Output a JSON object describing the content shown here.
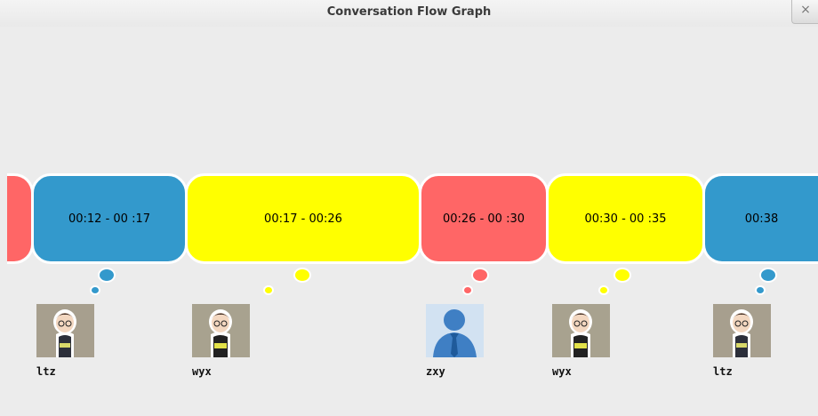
{
  "window": {
    "title": "Conversation Flow Graph",
    "close_symbol": "×"
  },
  "colors": {
    "blue": "#3399cc",
    "yellow": "#ffff00",
    "red": "#ff6666"
  },
  "segments": [
    {
      "label": "",
      "color": "#ff6666"
    },
    {
      "label": "00:12 - 00 :17",
      "color": "#3399cc"
    },
    {
      "label": "00:17 - 00:26",
      "color": "#ffff00"
    },
    {
      "label": "00:26 - 00 :30",
      "color": "#ff6666"
    },
    {
      "label": "00:30 - 00 :35",
      "color": "#ffff00"
    },
    {
      "label": "00:38",
      "color": "#3399cc"
    }
  ],
  "speakers": [
    {
      "name": "ltz",
      "avatar": "cartoon-boy-icon"
    },
    {
      "name": "wyx",
      "avatar": "cartoon-boy-icon"
    },
    {
      "name": "zxy",
      "avatar": "default-user-icon"
    },
    {
      "name": "wyx",
      "avatar": "cartoon-boy-icon"
    },
    {
      "name": "ltz",
      "avatar": "cartoon-boy-icon"
    }
  ]
}
